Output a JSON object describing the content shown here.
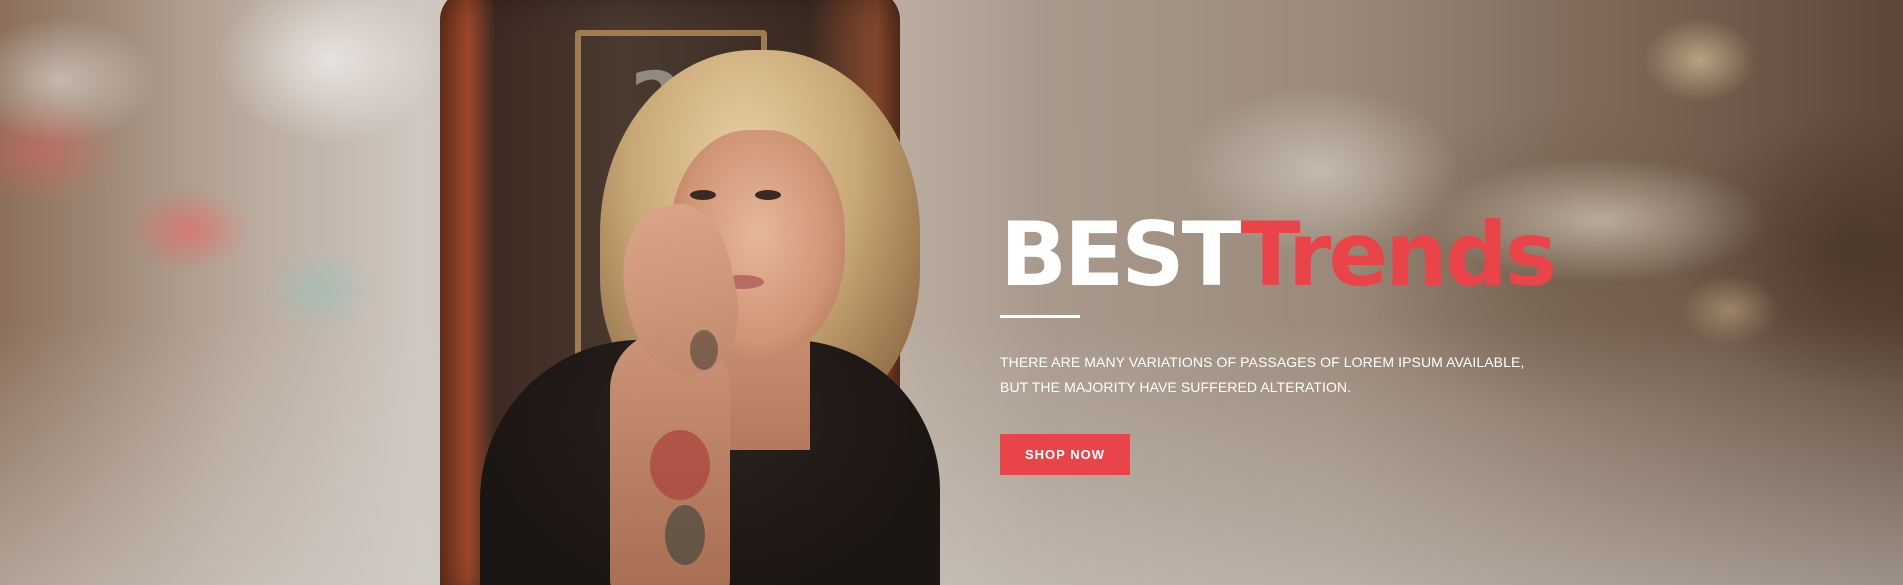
{
  "hero": {
    "background_image": "blurred-street-photo-woman-with-tattoos",
    "pillar_number": "2",
    "headline_strong": "BEST",
    "headline_accent": "Trends",
    "description_line1": "There are many variations of passages of Lorem Ipsum available,",
    "description_line2": "but the majority have suffered alteration.",
    "cta_label": "SHOP NOW"
  },
  "colors": {
    "accent": "#e8444a",
    "text": "#ffffff"
  }
}
